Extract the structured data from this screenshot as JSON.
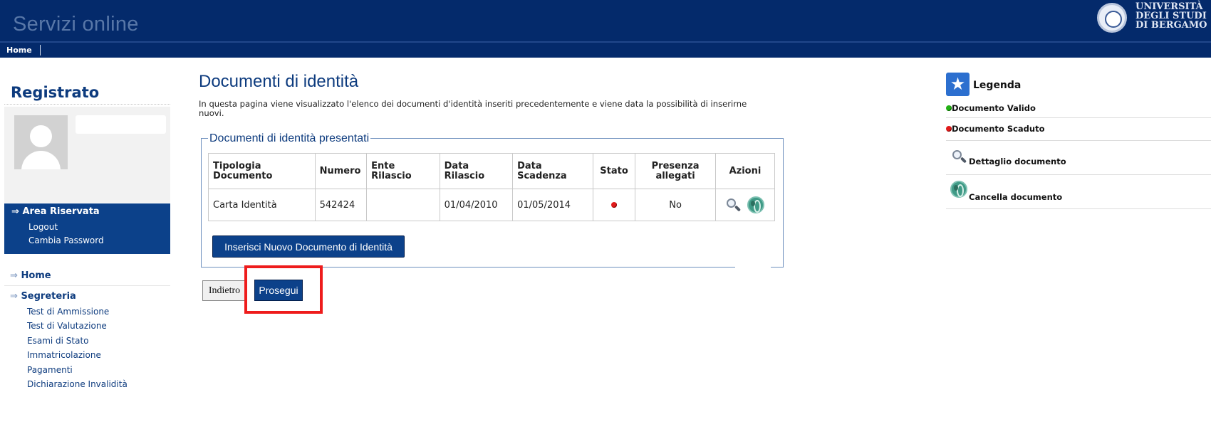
{
  "header": {
    "title": "Servizi online",
    "logo_text": "UNIVERSITÀ\nDEGLI STUDI\nDI BERGAMO"
  },
  "nav": {
    "home": "Home"
  },
  "sidebar": {
    "title": "Registrato",
    "area": {
      "title": "Area Riservata",
      "links": [
        "Logout",
        "Cambia Password"
      ]
    },
    "menu": {
      "home": "Home",
      "segreteria": "Segreteria",
      "segreteria_items": [
        "Test di Ammissione",
        "Test di Valutazione",
        "Esami di Stato",
        "Immatricolazione",
        "Pagamenti",
        "Dichiarazione Invalidità"
      ]
    },
    "arrow": "⇒"
  },
  "main": {
    "title": "Documenti di identità",
    "description": "In questa pagina viene visualizzato l'elenco dei documenti d'identità inseriti precedentemente e viene data la possibilità di inserirne nuovi.",
    "fieldset_legend": "Documenti di identità presentati",
    "table": {
      "headers": {
        "tipologia": "Tipologia Documento",
        "numero": "Numero",
        "ente": "Ente Rilascio",
        "data_rilascio": "Data Rilascio",
        "data_scadenza": "Data Scadenza",
        "stato": "Stato",
        "allegati": "Presenza allegati",
        "azioni": "Azioni"
      },
      "rows": [
        {
          "tipologia": "Carta Identità",
          "numero": "542424",
          "ente": "",
          "data_rilascio": "01/04/2010",
          "data_scadenza": "01/05/2014",
          "stato": "scaduto",
          "allegati": "No",
          "azioni": [
            "magnifier-icon",
            "globe-icon"
          ]
        }
      ]
    },
    "new_button": "Inserisci Nuovo Documento di Identità",
    "back_button": "Indietro",
    "next_button": "Prosegui"
  },
  "legend": {
    "title": "Legenda",
    "items": {
      "valido": "Documento Valido",
      "scaduto": "Documento Scaduto",
      "dettaglio": "Dettaglio documento",
      "cancella": "Cancella documento"
    }
  },
  "colors": {
    "header_bg": "#042a6b",
    "accent_blue": "#0c418a",
    "highlight_red": "#ee1c1c",
    "status_valid": "#23b014",
    "status_expired": "#e01b1b"
  }
}
